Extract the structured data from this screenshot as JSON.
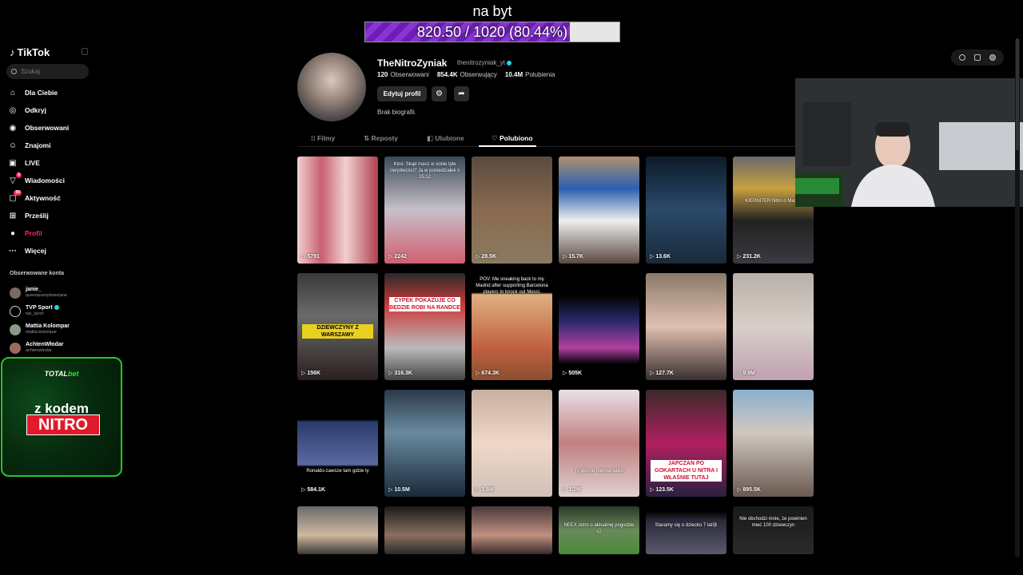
{
  "goal": {
    "title": "na byt",
    "progress_text": "820.50 / 1020 (80.44%)",
    "progress": 0.8044
  },
  "sidebar": {
    "logo": "TikTok",
    "search_placeholder": "Szukaj",
    "nav": [
      {
        "label": "Dla Ciebie",
        "icon": "home-icon"
      },
      {
        "label": "Odkryj",
        "icon": "compass-icon"
      },
      {
        "label": "Obserwowani",
        "icon": "following-icon"
      },
      {
        "label": "Znajomi",
        "icon": "friends-icon"
      },
      {
        "label": "LIVE",
        "icon": "live-icon"
      },
      {
        "label": "Wiadomości",
        "icon": "messages-icon",
        "badge": "5"
      },
      {
        "label": "Aktywność",
        "icon": "activity-icon",
        "badge": "99"
      },
      {
        "label": "Prześlij",
        "icon": "upload-icon"
      },
      {
        "label": "Profil",
        "icon": "profile-icon"
      },
      {
        "label": "Więcej",
        "icon": "more-icon"
      }
    ],
    "followed_title": "Obserwowane konta",
    "followed": [
      {
        "name": "janie_",
        "handle": "queenpussyboss|ane"
      },
      {
        "name": "TVP Sport",
        "handle": "tvp_sport",
        "verified": true
      },
      {
        "name": "Mattia Kolompar",
        "handle": "mattia.kolompar"
      },
      {
        "name": "AchtenWłodar",
        "handle": "achtenwlodar"
      }
    ],
    "ad": {
      "brand_a": "TOTAL",
      "brand_b": "bet",
      "line1": "z kodem",
      "code": "NITRO"
    }
  },
  "profile": {
    "name": "TheNitroZyniak",
    "handle": "thenitrozyniak_yt",
    "following_count": "120",
    "following_label": "Obserwowani",
    "followers_count": "854.4K",
    "followers_label": "Obserwujący",
    "likes_count": "10.4M",
    "likes_label": "Polubienia",
    "edit_label": "Edytuj profil",
    "bio": "Brak biografii."
  },
  "tabs": [
    {
      "label": "Filmy",
      "icon": "grid-icon"
    },
    {
      "label": "Reposty",
      "icon": "repost-icon"
    },
    {
      "label": "Ulubione",
      "icon": "bookmark-icon"
    },
    {
      "label": "Polubiono",
      "icon": "heart-icon",
      "active": true
    }
  ],
  "videos": [
    {
      "count": "5791"
    },
    {
      "count": "2242",
      "caption": "Ktoś: Skąd masz w sobie tyle cierpliwości? Ja w poniedziałek o 15:12"
    },
    {
      "count": "28.5K"
    },
    {
      "count": "15.7K"
    },
    {
      "count": "13.6K"
    },
    {
      "count": "231.2K",
      "caption": "KIERNITER Nitro o Maszy"
    },
    {
      "count": "156K",
      "caption": "DZIEWCZYNY Z WARSZAWY"
    },
    {
      "count": "316.3K",
      "caption": "CYPEK POKAZUJE CO BĘDZIE ROBI NA RANDCE"
    },
    {
      "count": "674.3K",
      "caption": "POV: Me sneaking back to my Madrid after supporting Barcelona players to knock out Messi."
    },
    {
      "count": "505K"
    },
    {
      "count": "127.7K"
    },
    {
      "count": "9.9M"
    },
    {
      "count": "584.1K",
      "caption": "Ronaldo-zawsze tam gdzie ty"
    },
    {
      "count": "10.5M"
    },
    {
      "count": "1.8M"
    },
    {
      "count": "1.2M",
      "caption": "Ty jedyne nieniwiniatko"
    },
    {
      "count": "123.5K",
      "caption": "JAPCZAN PO GOKARTACH U NITRA I WŁAŚNIE TUTAJ"
    },
    {
      "count": "895.5K"
    },
    {
      "count": ""
    },
    {
      "count": ""
    },
    {
      "count": ""
    },
    {
      "count": "",
      "caption": "NEEX ostro o aktualnej pogodzie 🌧"
    },
    {
      "count": "",
      "caption": "Staramy się o dziecko 7 lat😢"
    },
    {
      "count": "",
      "caption": "Nie obchodzi mnie, że powinien mieć 100 dziewczyn"
    }
  ],
  "colors": {
    "accent": "#fe2c55",
    "goal_fill": "#7a2ac6",
    "ad_border": "#2ac52a",
    "ad_code_bg": "#e01a2a"
  }
}
